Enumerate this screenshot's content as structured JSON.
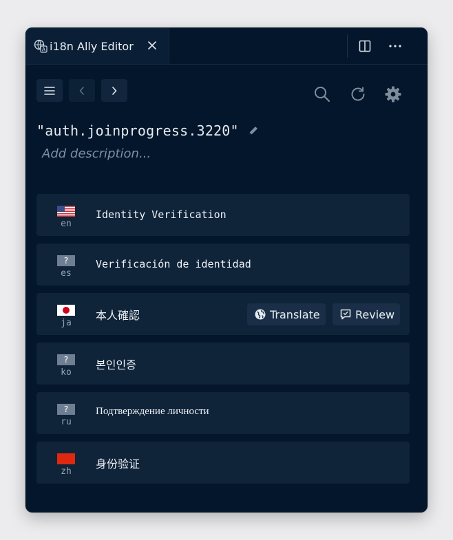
{
  "tab": {
    "title": "i18n Ally Editor"
  },
  "key": {
    "title": "\"auth.joinprogress.3220\"",
    "description_placeholder": "Add description..."
  },
  "locales": [
    {
      "code": "en",
      "flag": "us",
      "text": "Identity Verification"
    },
    {
      "code": "es",
      "flag": "unknown",
      "flag_text": "?",
      "text": "Verificación de identidad"
    },
    {
      "code": "ja",
      "flag": "jp",
      "text": "本人確認",
      "actions": {
        "translate": "Translate",
        "review": "Review"
      }
    },
    {
      "code": "ko",
      "flag": "unknown",
      "flag_text": "?",
      "text": "본인인증"
    },
    {
      "code": "ru",
      "flag": "unknown",
      "flag_text": "?",
      "text": "Подтверждение личности"
    },
    {
      "code": "zh",
      "flag": "cn",
      "text": "身份验证"
    }
  ],
  "icons": {
    "tab": "i18n-ally-icon",
    "close": "close-icon",
    "split": "split-editor-icon",
    "more": "more-icon",
    "menu": "menu-icon",
    "prev": "chevron-left-icon",
    "next": "chevron-right-icon",
    "search": "search-icon",
    "refresh": "refresh-icon",
    "settings": "gear-icon",
    "edit": "pencil-icon",
    "translate": "globe-icon",
    "review": "comment-icon"
  },
  "colors": {
    "background": "#04162b",
    "row": "#0f2339",
    "accent_text": "#eef2f6"
  }
}
